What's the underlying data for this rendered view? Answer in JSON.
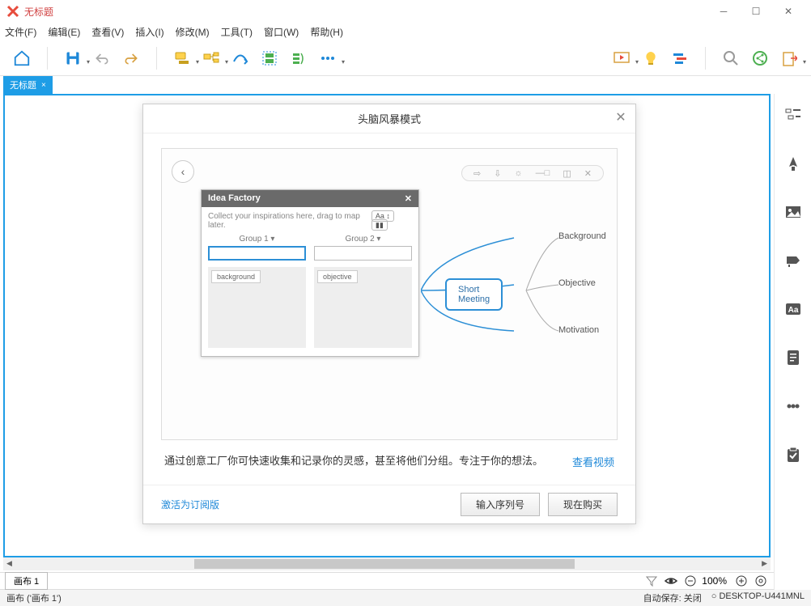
{
  "titlebar": {
    "title": "无标题"
  },
  "menu": {
    "file": "文件(F)",
    "edit": "编辑(E)",
    "view": "查看(V)",
    "insert": "插入(I)",
    "modify": "修改(M)",
    "tools": "工具(T)",
    "window": "窗口(W)",
    "help": "帮助(H)"
  },
  "tab": {
    "label": "无标题",
    "close": "×"
  },
  "sheet": {
    "label": "画布 1",
    "zoom": "100%"
  },
  "status": {
    "left": "画布 ('画布 1')",
    "autosave": "自动保存: 关闭",
    "device": "DESKTOP-U441MNL"
  },
  "dialog": {
    "title": "头脑风暴模式",
    "idea": {
      "header": "Idea Factory",
      "hint": "Collect your inspirations here, drag to map later.",
      "aa": "Aa",
      "g1": "Group 1",
      "g2": "Group 2",
      "tag1": "background",
      "tag2": "objective"
    },
    "map": {
      "root": "Short Meeting",
      "c1": "Background",
      "c2": "Objective",
      "c3": "Motivation"
    },
    "desc": "通过创意工厂你可快速收集和记录你的灵感，甚至将他们分组。专注于你的想法。",
    "video": "查看视频",
    "activate": "激活为订阅版",
    "serial": "输入序列号",
    "buy": "现在购买"
  }
}
